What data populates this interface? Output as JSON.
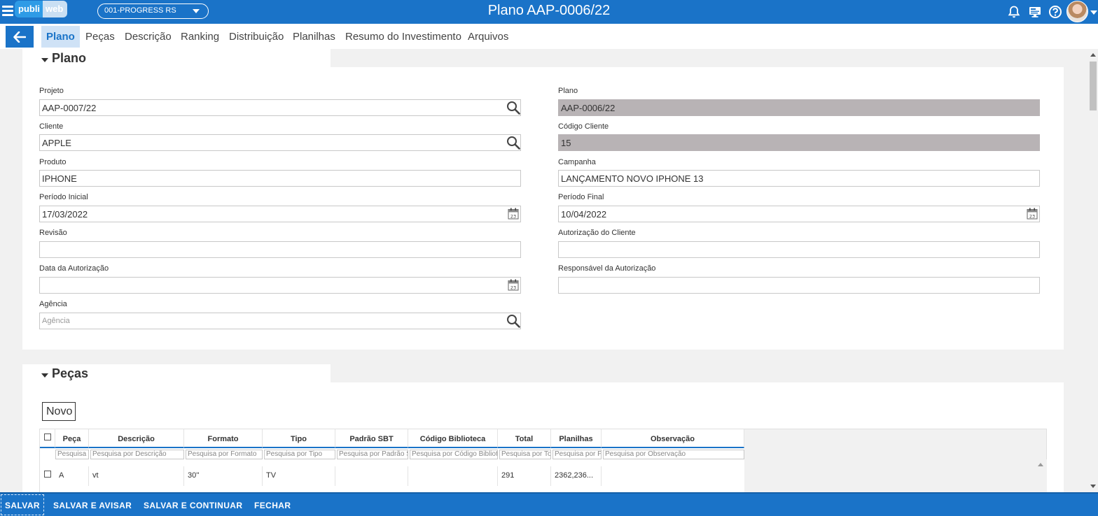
{
  "header": {
    "logo_part1": "publi",
    "logo_part2": "web",
    "company_select": "001-PROGRESS RS",
    "title": "Plano AAP-0006/22"
  },
  "tabs": [
    {
      "label": "Plano",
      "active": true
    },
    {
      "label": "Peças"
    },
    {
      "label": "Descrição"
    },
    {
      "label": "Ranking"
    },
    {
      "label": "Distribuição"
    },
    {
      "label": "Planilhas"
    },
    {
      "label": "Resumo do Investimento"
    },
    {
      "label": "Arquivos"
    }
  ],
  "plano_section": {
    "title": "Plano",
    "fields": {
      "projeto": {
        "label": "Projeto",
        "value": "AAP-0007/22"
      },
      "plano": {
        "label": "Plano",
        "value": "AAP-0006/22"
      },
      "cliente": {
        "label": "Cliente",
        "value": "APPLE"
      },
      "codigo_cliente": {
        "label": "Código Cliente",
        "value": "15"
      },
      "produto": {
        "label": "Produto",
        "value": "IPHONE"
      },
      "campanha": {
        "label": "Campanha",
        "value": "LANÇAMENTO NOVO IPHONE 13"
      },
      "periodo_inicial": {
        "label": "Período Inicial",
        "value": "17/03/2022"
      },
      "periodo_final": {
        "label": "Período Final",
        "value": "10/04/2022"
      },
      "revisao": {
        "label": "Revisão",
        "value": ""
      },
      "autorizacao_cliente": {
        "label": "Autorização do Cliente",
        "value": ""
      },
      "data_autorizacao": {
        "label": "Data da Autorização",
        "value": ""
      },
      "responsavel_autorizacao": {
        "label": "Responsável da Autorização",
        "value": ""
      },
      "agencia": {
        "label": "Agência",
        "placeholder": "Agência"
      }
    }
  },
  "pecas_section": {
    "title": "Peças",
    "novo_label": "Novo",
    "columns": [
      "Peça",
      "Descrição",
      "Formato",
      "Tipo",
      "Padrão SBT",
      "Código Biblioteca",
      "Total",
      "Planilhas",
      "Observação"
    ],
    "filters": [
      "Pesquisa por Peça",
      "Pesquisa por Descrição",
      "Pesquisa por Formato",
      "Pesquisa por Tipo",
      "Pesquisa por Padrão SBT",
      "Pesquisa por Código Biblioteca",
      "Pesquisa por Total",
      "Pesquisa por Planilhas",
      "Pesquisa por Observação"
    ],
    "rows": [
      {
        "peca": "A",
        "descricao": "vt",
        "formato": "30''",
        "tipo": "TV",
        "padrao_sbt": "",
        "codigo_biblioteca": "",
        "total": "291",
        "planilhas": "2362,236...",
        "observacao": ""
      }
    ]
  },
  "footer": {
    "salvar": "SALVAR",
    "salvar_avisar": "SALVAR E AVISAR",
    "salvar_continuar": "SALVAR E CONTINUAR",
    "fechar": "FECHAR"
  },
  "icons": {
    "menu": "hamburger-icon",
    "notifications": "bell-icon",
    "screen": "monitor-icon",
    "help": "help-icon",
    "back": "arrow-left-icon",
    "search": "magnifier-icon",
    "calendar": "calendar-icon"
  },
  "colors": {
    "primary": "#1a73c8",
    "tab_active_bg": "#cfe2f6",
    "readonly_field": "#b8b3b5"
  }
}
